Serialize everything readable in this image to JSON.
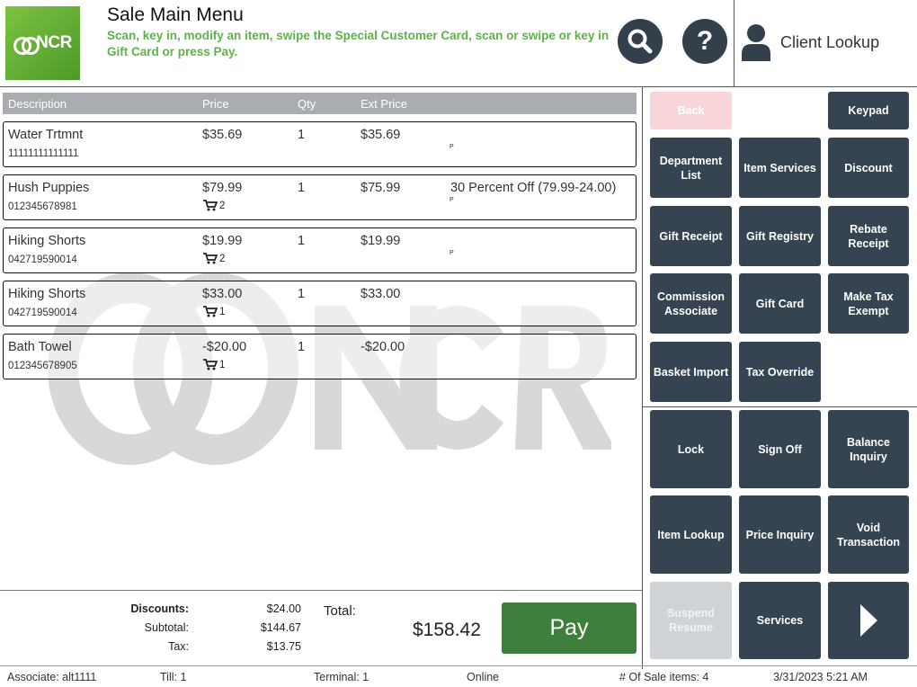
{
  "header": {
    "logo_text": "NCR",
    "title": "Sale Main Menu",
    "instructions": "Scan, key in, modify an item, swipe the Special Customer Card, scan or swipe or key in Gift Card or press Pay.",
    "search_icon": "search-icon",
    "help_icon": "help-icon",
    "client_lookup_label": "Client Lookup"
  },
  "table": {
    "headers": {
      "description": "Description",
      "price": "Price",
      "qty": "Qty",
      "ext_price": "Ext Price"
    },
    "rows": [
      {
        "description": "Water Trtmnt",
        "sku": "11111111111111",
        "price": "$35.69",
        "qty": "1",
        "ext_price": "$35.69",
        "cart_count": "",
        "note": "",
        "p_mark": "P"
      },
      {
        "description": "Hush Puppies",
        "sku": "012345678981",
        "price": "$79.99",
        "qty": "1",
        "ext_price": "$75.99",
        "cart_count": "2",
        "note": "30 Percent Off (79.99-24.00)",
        "p_mark": "P"
      },
      {
        "description": "Hiking Shorts",
        "sku": "042719590014",
        "price": "$19.99",
        "qty": "1",
        "ext_price": "$19.99",
        "cart_count": "2",
        "note": "",
        "p_mark": "P"
      },
      {
        "description": "Hiking Shorts",
        "sku": "042719590014",
        "price": "$33.00",
        "qty": "1",
        "ext_price": "$33.00",
        "cart_count": "1",
        "note": "",
        "p_mark": ""
      },
      {
        "description": "Bath Towel",
        "sku": "012345678905",
        "price": "-$20.00",
        "qty": "1",
        "ext_price": "-$20.00",
        "cart_count": "1",
        "note": "",
        "p_mark": ""
      }
    ]
  },
  "totals": {
    "discounts_label": "Discounts:",
    "discounts": "$24.00",
    "subtotal_label": "Subtotal:",
    "subtotal": "$144.67",
    "tax_label": "Tax:",
    "tax": "$13.75",
    "total_label": "Total:",
    "total": "$158.42",
    "pay_label": "Pay"
  },
  "buttons": {
    "back": "Back",
    "keypad": "Keypad",
    "department_list": "Department List",
    "item_services": "Item Services",
    "discount": "Discount",
    "gift_receipt": "Gift Receipt",
    "gift_registry": "Gift Registry",
    "rebate_receipt": "Rebate Receipt",
    "commission_associate": "Commission Associate",
    "gift_card": "Gift Card",
    "make_tax_exempt": "Make Tax Exempt",
    "basket_import": "Basket Import",
    "tax_override": "Tax Override",
    "lock": "Lock",
    "sign_off": "Sign Off",
    "balance_inquiry": "Balance Inquiry",
    "item_lookup": "Item Lookup",
    "price_inquiry": "Price Inquiry",
    "void_transaction": "Void Transaction",
    "suspend_resume": "Suspend Resume",
    "services": "Services",
    "next_icon": "chevron-right-icon"
  },
  "status_bar": {
    "associate": "Associate: alt1111",
    "till": "Till: 1",
    "terminal": "Terminal: 1",
    "connection": "Online",
    "sale_items": "# Of Sale items: 4",
    "datetime": "3/31/2023 5:21 AM"
  },
  "colors": {
    "header_green": "#5cb346",
    "logo_green": "#7dc242",
    "button_dark": "#364350",
    "pay_green": "#3f7e3d",
    "table_header_grey": "#a9adb2",
    "back_disabled": "#f7d5d9",
    "suspend_disabled": "#cfd2d6"
  }
}
